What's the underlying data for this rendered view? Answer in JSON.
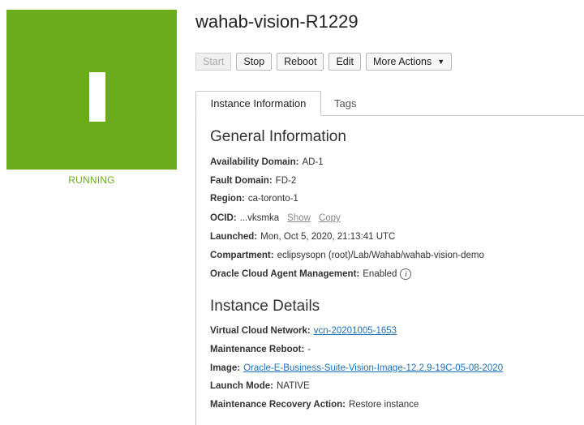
{
  "instance": {
    "name": "wahab-vision-R1229",
    "status": "RUNNING",
    "status_color": "#6aab1a"
  },
  "toolbar": {
    "start_label": "Start",
    "stop_label": "Stop",
    "reboot_label": "Reboot",
    "edit_label": "Edit",
    "more_actions_label": "More Actions",
    "more_actions_icon": "caret-down-icon"
  },
  "tabs": [
    {
      "label": "Instance Information",
      "active": true
    },
    {
      "label": "Tags",
      "active": false
    }
  ],
  "general": {
    "heading": "General Information",
    "availability_domain": {
      "label": "Availability Domain:",
      "value": "AD-1"
    },
    "fault_domain": {
      "label": "Fault Domain:",
      "value": "FD-2"
    },
    "region": {
      "label": "Region:",
      "value": "ca-toronto-1"
    },
    "ocid": {
      "label": "OCID:",
      "value": "...vksmka",
      "show_label": "Show",
      "copy_label": "Copy"
    },
    "launched": {
      "label": "Launched:",
      "value": "Mon, Oct 5, 2020, 21:13:41 UTC"
    },
    "compartment": {
      "label": "Compartment:",
      "value": "eclipsysopn (root)/Lab/Wahab/wahab-vision-demo"
    },
    "agent_management": {
      "label": "Oracle Cloud Agent Management:",
      "value": "Enabled",
      "icon": "info-icon",
      "icon_glyph": "i"
    }
  },
  "details": {
    "heading": "Instance Details",
    "vcn": {
      "label": "Virtual Cloud Network:",
      "value": "vcn-20201005-1653"
    },
    "maintenance_reboot": {
      "label": "Maintenance Reboot:",
      "value": "-"
    },
    "image": {
      "label": "Image:",
      "value": "Oracle-E-Business-Suite-Vision-Image-12.2.9-19C-05-08-2020"
    },
    "launch_mode": {
      "label": "Launch Mode:",
      "value": "NATIVE"
    },
    "recovery_action": {
      "label": "Maintenance Recovery Action:",
      "value": "Restore instance"
    }
  }
}
